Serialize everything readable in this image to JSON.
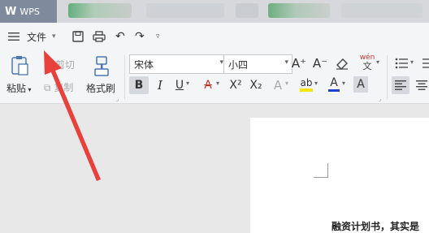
{
  "titlebar": {
    "app_tab_label": "WPS"
  },
  "quickbar": {
    "menu_label": "文件"
  },
  "ribbon": {
    "paste_label": "粘贴",
    "cut_label": "剪切",
    "copy_label": "复制",
    "format_painter_label": "格式刷",
    "font_name": "宋体",
    "font_size": "小四",
    "phonetic_label": "wén"
  },
  "document": {
    "text": "融资计划书，其实是"
  },
  "colors": {
    "arrow": "#e8413b",
    "accent_green": "#2e9a52",
    "titlebar_tab": "#7f8a9c"
  }
}
